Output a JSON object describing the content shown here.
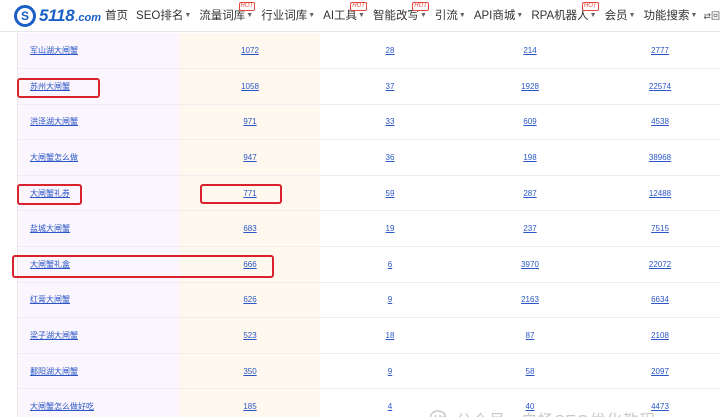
{
  "logo": {
    "brand": "5118",
    "domain": ".com"
  },
  "nav": [
    {
      "label": "首页",
      "caret": false,
      "hot": false
    },
    {
      "label": "SEO排名",
      "caret": true,
      "hot": false
    },
    {
      "label": "流量词库",
      "caret": true,
      "hot": true
    },
    {
      "label": "行业词库",
      "caret": true,
      "hot": false
    },
    {
      "label": "AI工具",
      "caret": true,
      "hot": true
    },
    {
      "label": "智能改写",
      "caret": true,
      "hot": true
    },
    {
      "label": "引流",
      "caret": true,
      "hot": false
    },
    {
      "label": "API商城",
      "caret": true,
      "hot": false
    },
    {
      "label": "RPA机器人",
      "caret": true,
      "hot": true
    },
    {
      "label": "会员",
      "caret": true,
      "hot": false
    },
    {
      "label": "功能搜索",
      "caret": true,
      "hot": false
    }
  ],
  "hot_label": "HOT",
  "old_version_label": "回旧版",
  "rows": [
    {
      "keyword": "军山湖大闸蟹",
      "c1": "1072",
      "c2": "28",
      "c3": "214",
      "c4": "2777"
    },
    {
      "keyword": "苏州大闸蟹",
      "c1": "1058",
      "c2": "37",
      "c3": "1928",
      "c4": "22574"
    },
    {
      "keyword": "洪泽湖大闸蟹",
      "c1": "971",
      "c2": "33",
      "c3": "609",
      "c4": "4538"
    },
    {
      "keyword": "大闸蟹怎么做",
      "c1": "947",
      "c2": "36",
      "c3": "198",
      "c4": "38968"
    },
    {
      "keyword": "大闸蟹礼券",
      "c1": "771",
      "c2": "59",
      "c3": "287",
      "c4": "12488"
    },
    {
      "keyword": "盐城大闸蟹",
      "c1": "683",
      "c2": "19",
      "c3": "237",
      "c4": "7515"
    },
    {
      "keyword": "大闸蟹礼盒",
      "c1": "666",
      "c2": "6",
      "c3": "3970",
      "c4": "22072"
    },
    {
      "keyword": "红膏大闸蟹",
      "c1": "626",
      "c2": "9",
      "c3": "2163",
      "c4": "6634"
    },
    {
      "keyword": "梁子湖大闸蟹",
      "c1": "523",
      "c2": "18",
      "c3": "87",
      "c4": "2108"
    },
    {
      "keyword": "鄱阳湖大闸蟹",
      "c1": "350",
      "c2": "9",
      "c3": "58",
      "c4": "2097"
    },
    {
      "keyword": "大闸蟹怎么做好吃",
      "c1": "185",
      "c2": "4",
      "c3": "40",
      "c4": "4473"
    }
  ],
  "watermark": "公众号 · 白杨SEO优化教程",
  "colors": {
    "brand": "#1a5fc6",
    "link": "#2a56c6",
    "highlight": "#d8222d",
    "hot": "#e6473d"
  }
}
